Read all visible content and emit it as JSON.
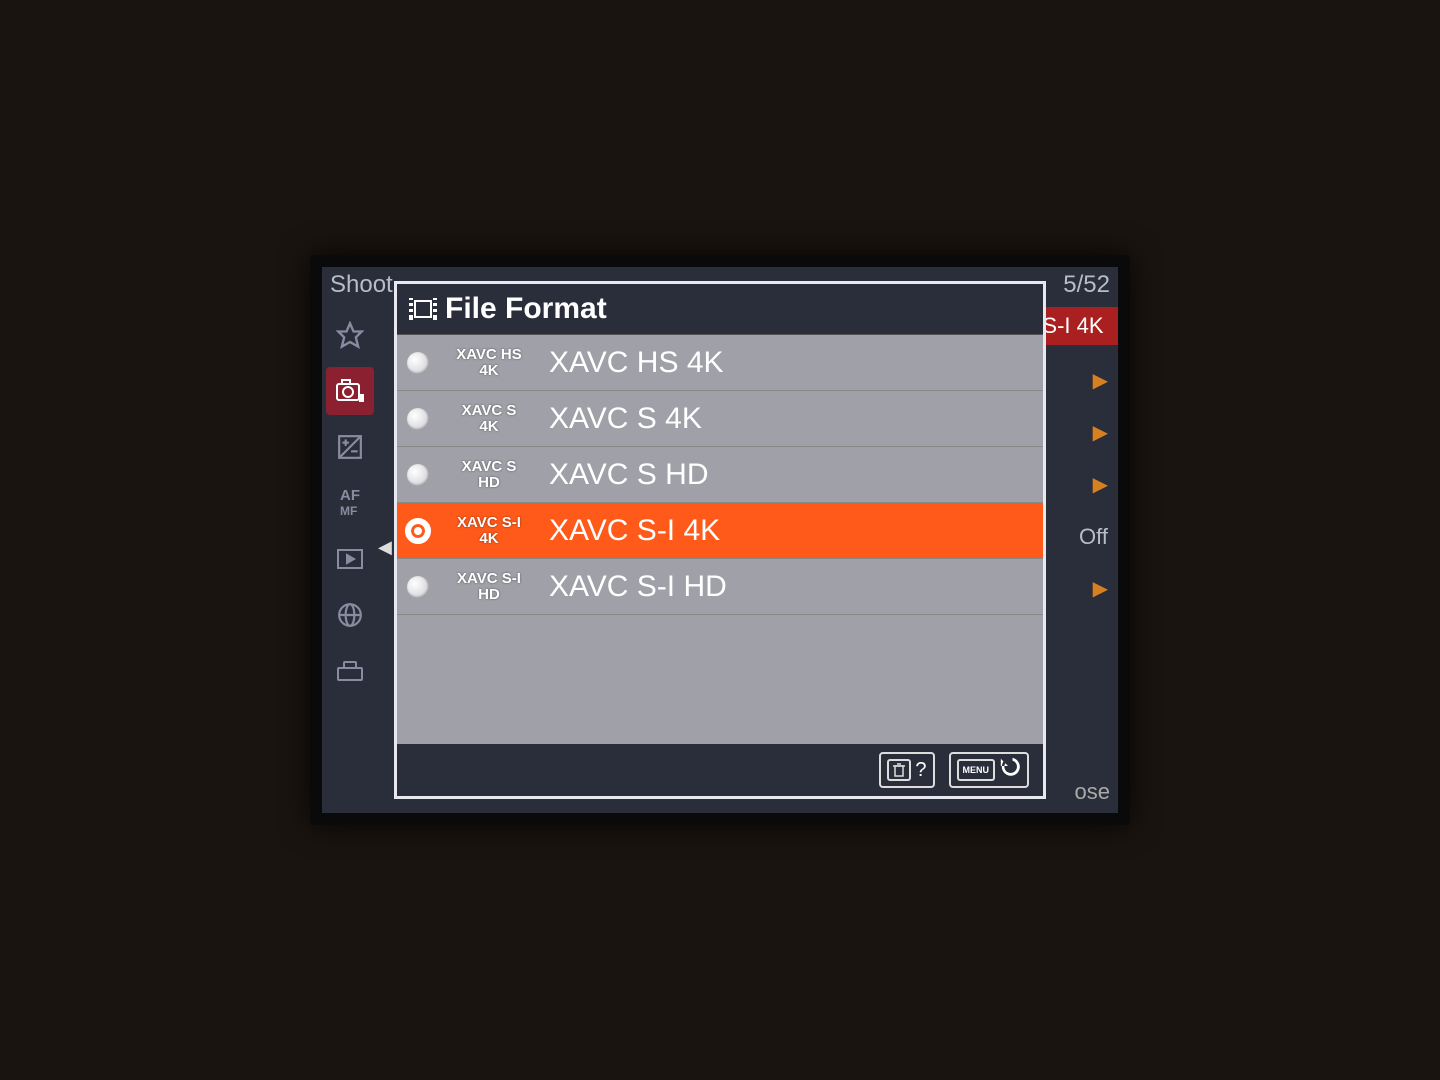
{
  "bg": {
    "header_left": "Shoot",
    "page_counter": "5/52",
    "current_value_short": "S-I 4K",
    "off_label": "Off",
    "close_label": "ose"
  },
  "popup": {
    "title": "File Format",
    "options": [
      {
        "badge_top": "XAVC HS",
        "badge_bottom": "4K",
        "label": "XAVC HS 4K",
        "selected": false
      },
      {
        "badge_top": "XAVC S",
        "badge_bottom": "4K",
        "label": "XAVC S 4K",
        "selected": false
      },
      {
        "badge_top": "XAVC S",
        "badge_bottom": "HD",
        "label": "XAVC S HD",
        "selected": false
      },
      {
        "badge_top": "XAVC S-I",
        "badge_bottom": "4K",
        "label": "XAVC S-I 4K",
        "selected": true
      },
      {
        "badge_top": "XAVC S-I",
        "badge_bottom": "HD",
        "label": "XAVC S-I HD",
        "selected": false
      }
    ],
    "footer": {
      "help_symbol": "?",
      "menu_label": "MENU"
    }
  }
}
